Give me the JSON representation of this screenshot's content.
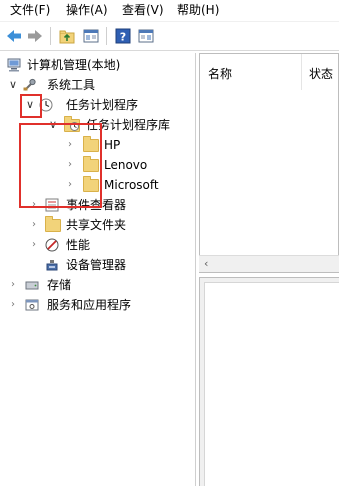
{
  "menu": {
    "file": "文件(F)",
    "action": "操作(A)",
    "view": "查看(V)",
    "help": "帮助(H)"
  },
  "toolbar": {
    "icons": [
      "back-arrow-icon",
      "forward-arrow-icon",
      "up-folder-icon",
      "show-hide-tree-icon",
      "help-icon",
      "show-hide-action-pane-icon"
    ]
  },
  "tree": {
    "root": "计算机管理(本地)",
    "system_tools": "系统工具",
    "task_scheduler": "任务计划程序",
    "task_scheduler_library": "任务计划程序库",
    "folders": [
      "HP",
      "Lenovo",
      "Microsoft"
    ],
    "event_viewer": "事件查看器",
    "shared_folders": "共享文件夹",
    "performance": "性能",
    "device_manager": "设备管理器",
    "storage": "存储",
    "services_apps": "服务和应用程序"
  },
  "list": {
    "columns": [
      "名称",
      "状态"
    ]
  },
  "colors": {
    "highlight_red": "#e0302b",
    "folder_yellow": "#f2d37a",
    "back_arrow": "#3c8fd8"
  }
}
